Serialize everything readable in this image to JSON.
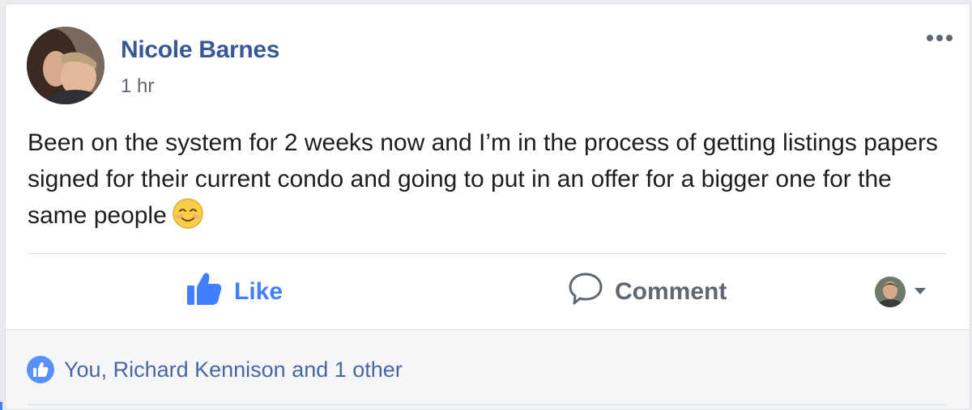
{
  "post": {
    "author_name": "Nicole Barnes",
    "timestamp": "1 hr",
    "body_text": "Been on the system for 2 weeks now and I’m in the process of getting listings papers signed for their current condo and going to put in an offer for a bigger one for the same people",
    "emoji": "smiling-face-icon"
  },
  "actions": {
    "like_label": "Like",
    "comment_label": "Comment"
  },
  "reactions": {
    "summary": "You, Richard Kennison and 1 other"
  },
  "colors": {
    "link_blue": "#385898",
    "like_blue": "#4080ff",
    "badge_blue": "#5890ff",
    "text": "#1c1e21",
    "muted": "#606770"
  },
  "icons": {
    "options": "more-options-icon",
    "like": "thumbs-up-icon",
    "comment": "comment-bubble-icon",
    "dropdown": "caret-down-icon"
  }
}
